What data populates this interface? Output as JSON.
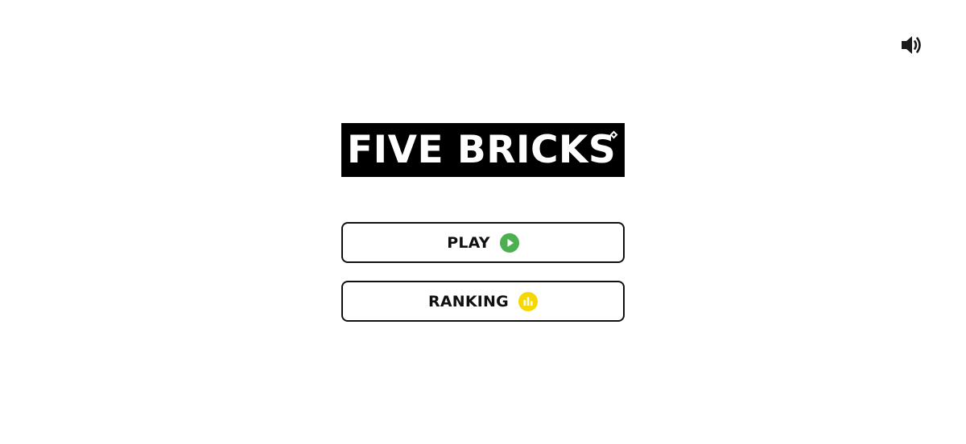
{
  "game": {
    "title": "FIVE BRICKS"
  },
  "controls": {
    "sound_icon": "speaker-volume-icon",
    "sound_on": true
  },
  "menu": {
    "play": {
      "label": "PLAY",
      "icon": "play-circle-icon",
      "icon_color": "#4CAF50"
    },
    "ranking": {
      "label": "RANKING",
      "icon": "bar-chart-icon",
      "icon_color": "#F5D800"
    }
  },
  "colors": {
    "background": "#FFFFFF",
    "logo_background": "#000000",
    "logo_text": "#FFFFFF",
    "button_border": "#111111"
  }
}
